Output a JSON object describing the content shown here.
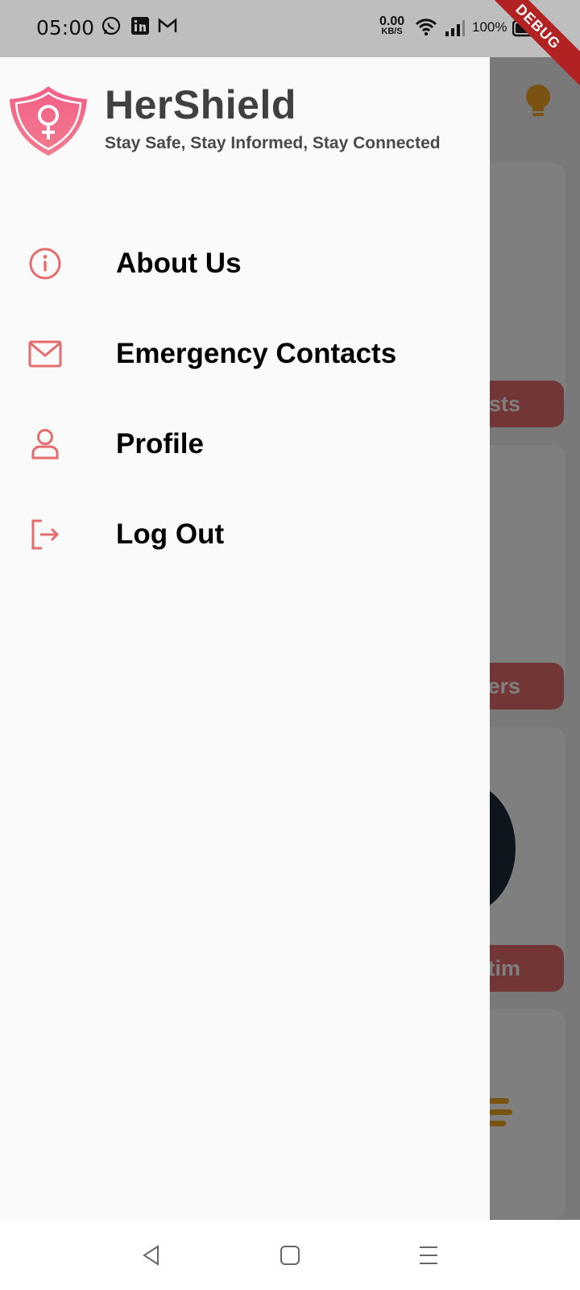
{
  "status_bar": {
    "time": "05:00",
    "net_speed_value": "0.00",
    "net_speed_unit": "KB/S",
    "battery": "100%",
    "icons": [
      "whatsapp-icon",
      "linkedin-icon",
      "gmail-icon",
      "wifi-icon",
      "signal-icon",
      "battery-icon"
    ]
  },
  "debug_banner": "DEBUG",
  "drawer": {
    "title": "HerShield",
    "tagline": "Stay Safe, Stay Informed, Stay Connected",
    "items": [
      {
        "label": "About Us",
        "icon": "info-icon"
      },
      {
        "label": "Emergency Contacts",
        "icon": "mail-icon"
      },
      {
        "label": "Profile",
        "icon": "person-icon"
      },
      {
        "label": "Log Out",
        "icon": "logout-icon"
      }
    ]
  },
  "background": {
    "buttons": [
      "sts",
      "ers",
      "tim"
    ]
  },
  "colors": {
    "accent": "#e46c6c",
    "logo_pink": "#f25b82",
    "drawer_bg": "#fafafa"
  }
}
